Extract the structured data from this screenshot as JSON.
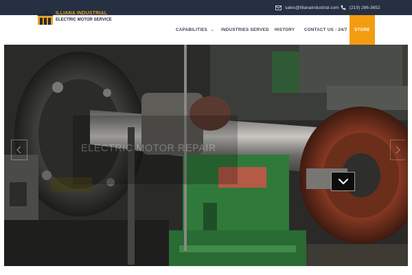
{
  "topbar": {
    "email": "sales@illianaindustrial.com",
    "phone": "(219) 286-3652",
    "email_icon": "envelope-icon",
    "phone_icon": "phone-icon"
  },
  "logo": {
    "line1": "ILLIANA INDUSTRIAL",
    "line2": "ELECTRIC MOTOR SERVICE",
    "brand_color": "#e8a020"
  },
  "nav": {
    "items": [
      {
        "label": "CAPABILITIES",
        "has_dropdown": true
      },
      {
        "label": "INDUSTRIES SERVED"
      },
      {
        "label": "HISTORY"
      },
      {
        "label": "CONTACT US - 24/7"
      },
      {
        "label": "STORE"
      }
    ],
    "accent_color": "#f39c12"
  },
  "hero": {
    "title": "ELECTRIC MOTOR REPAIR",
    "scroll_icon": "chevron-down-icon",
    "prev_icon": "chevron-left-icon",
    "next_icon": "chevron-right-icon"
  },
  "colors": {
    "topbar_bg": "#253042",
    "machine_green": "#2f7a3a",
    "rotor_copper": "#8a3a22"
  }
}
